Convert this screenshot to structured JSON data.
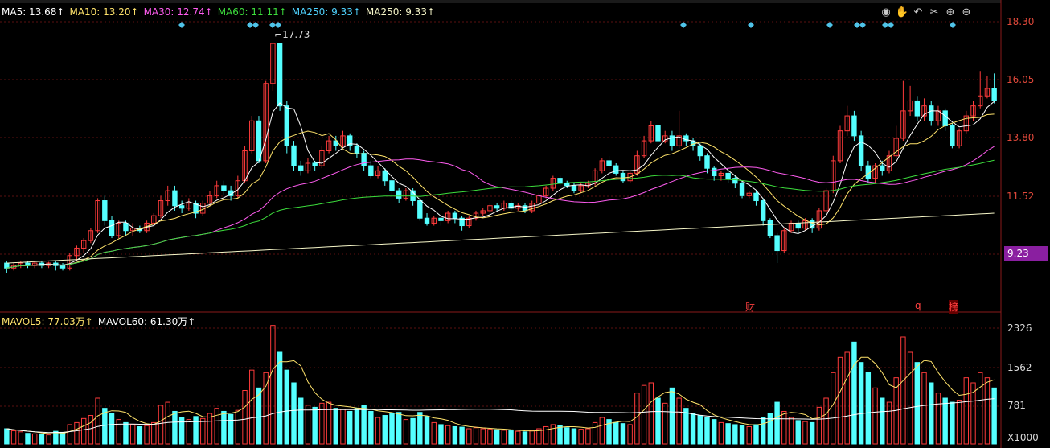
{
  "ma_legend": [
    {
      "label": "MA5: 13.68↑",
      "color": "#ffffff"
    },
    {
      "label": "MA10: 13.20↑",
      "color": "#ffe36b"
    },
    {
      "label": "MA30: 12.74↑",
      "color": "#ff5cf0"
    },
    {
      "label": "MA60: 11.11↑",
      "color": "#3cdc3c"
    },
    {
      "label": "MA250: 9.33↑",
      "color": "#4fd3ff"
    },
    {
      "label": "MA250: 9.33↑",
      "color": "#f6f6c8"
    }
  ],
  "vol_legend": [
    {
      "label": "MAVOL5: 77.03万↑",
      "color": "#ffe36b"
    },
    {
      "label": "MAVOL60: 61.30万↑",
      "color": "#ffffff"
    }
  ],
  "price_axis": [
    "18.30",
    "16.05",
    "13.80",
    "11.52",
    "9.23"
  ],
  "vol_axis": [
    "2326",
    "1562",
    "781",
    "X1000"
  ],
  "current_price": "9.23",
  "high_label": "17.73",
  "event_marks": [
    "财",
    "q",
    "榜"
  ],
  "toolbar_icons": [
    "eye-icon",
    "hand-icon",
    "undo-icon",
    "scissors-icon",
    "zoom-in-icon",
    "zoom-out-icon"
  ],
  "colors": {
    "up": "#ff3b3b",
    "down": "#54ffff",
    "grid": "#5a0f0f",
    "axis_text": "#e0483a"
  },
  "chart_data": {
    "type": "candlestick",
    "price_ylim": [
      7.0,
      18.8
    ],
    "vol_ylim": [
      0,
      2400
    ],
    "candles": [
      [
        8.9,
        8.7,
        9.0,
        8.5,
        300
      ],
      [
        8.7,
        8.8,
        8.9,
        8.6,
        260
      ],
      [
        8.8,
        8.9,
        9.0,
        8.7,
        240
      ],
      [
        8.9,
        8.8,
        9.0,
        8.7,
        210
      ],
      [
        8.8,
        8.9,
        9.0,
        8.7,
        200
      ],
      [
        8.9,
        8.8,
        9.0,
        8.7,
        190
      ],
      [
        8.8,
        8.9,
        8.95,
        8.7,
        180
      ],
      [
        8.9,
        8.8,
        9.0,
        8.6,
        250
      ],
      [
        8.8,
        8.7,
        8.9,
        8.6,
        230
      ],
      [
        8.7,
        9.2,
        9.3,
        8.6,
        380
      ],
      [
        9.2,
        9.5,
        9.6,
        9.0,
        420
      ],
      [
        9.5,
        9.8,
        9.9,
        9.3,
        500
      ],
      [
        9.8,
        10.2,
        10.3,
        9.7,
        560
      ],
      [
        10.2,
        11.4,
        11.5,
        10.1,
        900
      ],
      [
        11.4,
        10.6,
        11.6,
        10.4,
        700
      ],
      [
        10.6,
        10.0,
        10.8,
        9.9,
        600
      ],
      [
        10.0,
        10.5,
        10.6,
        9.9,
        480
      ],
      [
        10.5,
        10.2,
        10.6,
        10.0,
        420
      ],
      [
        10.2,
        10.3,
        10.5,
        10.0,
        380
      ],
      [
        10.3,
        10.2,
        10.4,
        10.1,
        340
      ],
      [
        10.2,
        10.5,
        10.6,
        10.1,
        360
      ],
      [
        10.5,
        10.8,
        10.9,
        10.4,
        420
      ],
      [
        10.8,
        11.4,
        11.6,
        10.7,
        760
      ],
      [
        11.4,
        11.8,
        12.0,
        11.2,
        820
      ],
      [
        11.8,
        11.2,
        12.0,
        11.0,
        640
      ],
      [
        11.2,
        11.1,
        11.4,
        10.9,
        520
      ],
      [
        11.1,
        11.3,
        11.5,
        11.0,
        480
      ],
      [
        11.3,
        10.9,
        11.4,
        10.7,
        540
      ],
      [
        10.9,
        11.3,
        11.4,
        10.8,
        500
      ],
      [
        11.3,
        11.6,
        11.8,
        11.2,
        600
      ],
      [
        11.6,
        12.0,
        12.2,
        11.5,
        700
      ],
      [
        12.0,
        11.8,
        12.2,
        11.6,
        640
      ],
      [
        11.8,
        11.6,
        12.0,
        11.4,
        580
      ],
      [
        11.6,
        12.2,
        12.4,
        11.5,
        660
      ],
      [
        12.2,
        13.4,
        13.6,
        12.1,
        1050
      ],
      [
        13.4,
        14.6,
        14.8,
        13.3,
        1450
      ],
      [
        14.6,
        13.0,
        14.8,
        12.9,
        1100
      ],
      [
        13.0,
        16.1,
        16.2,
        12.9,
        1400
      ],
      [
        16.1,
        17.7,
        17.73,
        15.8,
        2326
      ],
      [
        17.7,
        15.2,
        17.7,
        15.0,
        1800
      ],
      [
        15.2,
        13.6,
        15.4,
        13.3,
        1450
      ],
      [
        13.6,
        12.8,
        13.8,
        12.6,
        1200
      ],
      [
        12.8,
        12.6,
        13.0,
        12.4,
        900
      ],
      [
        12.6,
        12.9,
        13.1,
        12.5,
        760
      ],
      [
        12.9,
        12.8,
        13.0,
        12.6,
        720
      ],
      [
        12.8,
        13.4,
        13.6,
        12.7,
        800
      ],
      [
        13.4,
        13.8,
        14.0,
        13.3,
        820
      ],
      [
        13.8,
        13.6,
        14.0,
        13.4,
        700
      ],
      [
        13.6,
        14.0,
        14.2,
        13.5,
        680
      ],
      [
        14.0,
        13.6,
        14.1,
        13.4,
        640
      ],
      [
        13.6,
        13.3,
        13.7,
        13.1,
        700
      ],
      [
        13.3,
        12.8,
        13.4,
        12.6,
        760
      ],
      [
        12.8,
        12.4,
        13.0,
        12.3,
        640
      ],
      [
        12.4,
        12.6,
        12.8,
        12.3,
        520
      ],
      [
        12.6,
        12.2,
        12.7,
        12.0,
        560
      ],
      [
        12.2,
        11.8,
        12.3,
        11.6,
        600
      ],
      [
        11.8,
        11.5,
        11.9,
        11.3,
        620
      ],
      [
        11.5,
        11.8,
        11.9,
        11.4,
        480
      ],
      [
        11.8,
        11.4,
        11.9,
        11.2,
        500
      ],
      [
        11.4,
        10.7,
        11.5,
        10.6,
        620
      ],
      [
        10.7,
        10.5,
        10.9,
        10.4,
        540
      ],
      [
        10.5,
        10.7,
        10.8,
        10.4,
        420
      ],
      [
        10.7,
        10.6,
        10.8,
        10.4,
        380
      ],
      [
        10.6,
        10.9,
        11.0,
        10.5,
        360
      ],
      [
        10.9,
        10.7,
        11.0,
        10.5,
        340
      ],
      [
        10.7,
        10.4,
        10.8,
        10.2,
        330
      ],
      [
        10.4,
        10.7,
        10.8,
        10.3,
        300
      ],
      [
        10.7,
        10.9,
        11.0,
        10.6,
        320
      ],
      [
        10.9,
        11.0,
        11.1,
        10.8,
        300
      ],
      [
        11.0,
        11.2,
        11.3,
        10.9,
        290
      ],
      [
        11.2,
        11.1,
        11.3,
        11.0,
        280
      ],
      [
        11.1,
        11.3,
        11.4,
        11.0,
        270
      ],
      [
        11.3,
        11.1,
        11.4,
        11.0,
        260
      ],
      [
        11.1,
        11.2,
        11.3,
        11.0,
        250
      ],
      [
        11.2,
        11.0,
        11.3,
        10.9,
        240
      ],
      [
        11.0,
        11.3,
        11.4,
        10.9,
        260
      ],
      [
        11.3,
        11.6,
        11.7,
        11.2,
        300
      ],
      [
        11.6,
        11.9,
        12.0,
        11.5,
        340
      ],
      [
        11.9,
        12.3,
        12.4,
        11.8,
        380
      ],
      [
        12.3,
        12.1,
        12.4,
        12.0,
        360
      ],
      [
        12.1,
        12.0,
        12.2,
        11.9,
        320
      ],
      [
        12.0,
        11.8,
        12.1,
        11.7,
        300
      ],
      [
        11.8,
        12.0,
        12.1,
        11.7,
        290
      ],
      [
        12.0,
        12.1,
        12.2,
        11.9,
        300
      ],
      [
        12.1,
        12.6,
        12.7,
        12.0,
        420
      ],
      [
        12.6,
        13.0,
        13.1,
        12.5,
        520
      ],
      [
        13.0,
        12.8,
        13.2,
        12.6,
        480
      ],
      [
        12.8,
        12.5,
        12.9,
        12.4,
        420
      ],
      [
        12.5,
        12.2,
        12.6,
        12.1,
        400
      ],
      [
        12.2,
        12.5,
        12.6,
        12.1,
        380
      ],
      [
        12.5,
        13.2,
        13.4,
        12.4,
        1000
      ],
      [
        13.2,
        13.8,
        14.0,
        13.1,
        1150
      ],
      [
        13.8,
        14.4,
        14.6,
        13.7,
        1200
      ],
      [
        14.4,
        13.8,
        14.6,
        13.6,
        900
      ],
      [
        13.8,
        14.0,
        14.2,
        13.7,
        800
      ],
      [
        14.0,
        13.6,
        14.2,
        13.4,
        1100
      ],
      [
        13.6,
        14.0,
        15.0,
        13.5,
        900
      ],
      [
        14.0,
        13.8,
        14.1,
        13.6,
        700
      ],
      [
        13.8,
        13.6,
        13.9,
        13.4,
        600
      ],
      [
        13.6,
        13.2,
        13.7,
        13.0,
        560
      ],
      [
        13.2,
        12.7,
        13.3,
        12.5,
        520
      ],
      [
        12.7,
        12.4,
        12.8,
        12.2,
        480
      ],
      [
        12.4,
        12.5,
        12.6,
        12.2,
        420
      ],
      [
        12.5,
        12.3,
        12.6,
        12.1,
        400
      ],
      [
        12.3,
        12.1,
        12.4,
        11.9,
        380
      ],
      [
        12.1,
        11.6,
        12.2,
        11.5,
        360
      ],
      [
        11.6,
        11.7,
        11.8,
        11.5,
        340
      ],
      [
        11.7,
        11.4,
        11.8,
        11.2,
        380
      ],
      [
        11.4,
        10.6,
        11.5,
        10.4,
        520
      ],
      [
        10.6,
        10.0,
        10.7,
        9.9,
        600
      ],
      [
        10.0,
        9.4,
        10.1,
        8.9,
        820
      ],
      [
        9.4,
        10.2,
        10.3,
        9.3,
        640
      ],
      [
        10.2,
        10.5,
        10.6,
        10.1,
        520
      ],
      [
        10.5,
        10.3,
        10.6,
        10.1,
        460
      ],
      [
        10.3,
        10.6,
        10.7,
        10.2,
        440
      ],
      [
        10.6,
        10.3,
        10.7,
        10.1,
        420
      ],
      [
        10.3,
        11.0,
        11.1,
        10.2,
        720
      ],
      [
        11.0,
        11.8,
        11.9,
        10.9,
        900
      ],
      [
        11.8,
        13.0,
        13.2,
        11.7,
        1400
      ],
      [
        13.0,
        14.2,
        14.4,
        12.9,
        1700
      ],
      [
        14.2,
        14.8,
        15.2,
        14.0,
        1800
      ],
      [
        14.8,
        14.0,
        15.0,
        13.8,
        2000
      ],
      [
        14.0,
        12.8,
        14.2,
        12.6,
        1600
      ],
      [
        12.8,
        12.3,
        13.0,
        12.1,
        1400
      ],
      [
        12.3,
        12.8,
        12.9,
        12.1,
        1100
      ],
      [
        12.8,
        12.6,
        13.0,
        12.4,
        900
      ],
      [
        12.6,
        13.2,
        13.4,
        12.5,
        820
      ],
      [
        13.2,
        13.9,
        14.4,
        13.1,
        1300
      ],
      [
        13.9,
        15.0,
        16.2,
        13.8,
        2100
      ],
      [
        15.0,
        15.4,
        16.0,
        14.8,
        1800
      ],
      [
        15.4,
        14.8,
        15.6,
        14.6,
        1600
      ],
      [
        14.8,
        15.2,
        15.5,
        14.6,
        1400
      ],
      [
        15.2,
        14.6,
        15.4,
        14.4,
        1200
      ],
      [
        14.6,
        15.0,
        15.2,
        14.4,
        1000
      ],
      [
        15.0,
        14.4,
        15.1,
        14.2,
        900
      ],
      [
        14.4,
        13.6,
        14.5,
        13.5,
        820
      ],
      [
        13.6,
        14.2,
        14.3,
        13.5,
        860
      ],
      [
        14.2,
        14.8,
        15.0,
        14.1,
        1300
      ],
      [
        14.8,
        15.2,
        15.4,
        14.6,
        1200
      ],
      [
        15.2,
        15.6,
        16.6,
        15.1,
        1400
      ],
      [
        15.6,
        15.9,
        16.4,
        15.5,
        1300
      ],
      [
        15.9,
        15.4,
        16.5,
        15.3,
        1100
      ]
    ],
    "ma_lines_legend_only": true
  }
}
